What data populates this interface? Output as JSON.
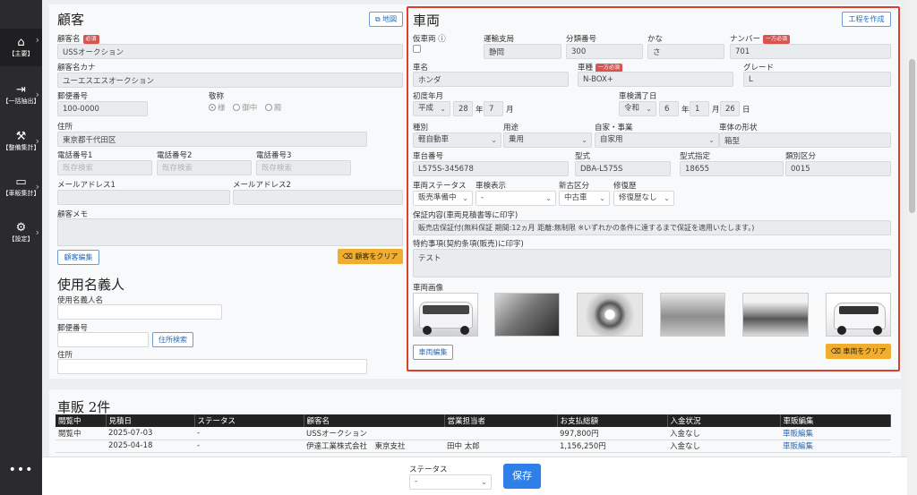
{
  "sidebar": {
    "items": [
      {
        "label": "【主要】",
        "icon": "home-icon",
        "glyph": "🏠"
      },
      {
        "label": "【一括抽出】",
        "icon": "export-icon",
        "glyph": "⮕"
      },
      {
        "label": "【整備集計】",
        "icon": "wrench-icon",
        "glyph": "🔧"
      },
      {
        "label": "【車販集計】",
        "icon": "car-icon",
        "glyph": "🚗"
      },
      {
        "label": "【設定】",
        "icon": "gear-icon",
        "glyph": "⚙"
      }
    ],
    "more": "•••"
  },
  "customer": {
    "title": "顧客",
    "map_button": "地図",
    "name_label": "顧客名",
    "required": "必須",
    "name": "USSオークション",
    "kana_label": "顧客名カナ",
    "kana": "ユーエスエスオークション",
    "postal_label": "郵便番号",
    "postal": "100-0000",
    "honorific_label": "敬称",
    "honorifics": [
      "様",
      "御中",
      "殿"
    ],
    "address_label": "住所",
    "address": "東京都千代田区",
    "phone1_label": "電話番号1",
    "phone2_label": "電話番号2",
    "phone3_label": "電話番号3",
    "phone_placeholder": "既存検索",
    "email1_label": "メールアドレス1",
    "email2_label": "メールアドレス2",
    "memo_label": "顧客メモ",
    "edit_button": "顧客編集",
    "clear_button": "顧客をクリア"
  },
  "nominee": {
    "title": "使用名義人",
    "name_label": "使用名義人名",
    "postal_label": "郵便番号",
    "search_button": "住所検索",
    "address_label": "住所"
  },
  "vehicle": {
    "title": "車両",
    "create_button": "工程を作成",
    "temp_label": "仮車両",
    "bureau_label": "運輸支局",
    "bureau": "静岡",
    "class_label": "分類番号",
    "class": "300",
    "kana_label": "かな",
    "kana": "さ",
    "number_label": "ナンバー",
    "number_req": "一方必須",
    "number": "701",
    "maker_label": "車名",
    "maker": "ホンダ",
    "model_label": "車種",
    "model_req": "一方必須",
    "model": "N-BOX+",
    "grade_label": "グレード",
    "grade": "L",
    "first_reg_label": "初度年月",
    "first_era": "平成",
    "first_year": "28",
    "first_month": "7",
    "year_unit": "年",
    "month_unit": "月",
    "day_unit": "日",
    "inspection_label": "車検満了日",
    "insp_era": "令和",
    "insp_year": "6",
    "insp_month": "1",
    "insp_day": "26",
    "type_label": "種別",
    "type": "軽自動車",
    "usage_label": "用途",
    "usage": "乗用",
    "biz_label": "自家・事業",
    "biz": "自家用",
    "body_label": "車体の形状",
    "body": "箱型",
    "chassis_label": "車台番号",
    "chassis": "L575S-345678",
    "katashiki_label": "型式",
    "katashiki": "DBA-L575S",
    "katashiki_spec_label": "型式指定",
    "katashiki_spec": "18655",
    "category_label": "類別区分",
    "category": "0015",
    "status_label": "車両ステータス",
    "status": "販売準備中",
    "insp_display_label": "車検表示",
    "insp_display": "-",
    "newused_label": "新古区分",
    "newused": "中古車",
    "repair_label": "修復歴",
    "repair": "修復歴なし",
    "warranty_label": "保証内容(車両見積書等に印字)",
    "warranty": "販売店保証付(無料保証 期間:12ヵ月 距離:無制限 ※いずれかの条件に達するまで保証を適用いたします。)",
    "special_label": "特約事項(契約条項(販売)に印字)",
    "special": "テスト",
    "images_label": "車両画像",
    "edit_button": "車両編集",
    "clear_button": "車両をクリア"
  },
  "sales": {
    "title": "車販 2件",
    "columns": [
      "閲覧中",
      "見積日",
      "ステータス",
      "顧客名",
      "営業担当者",
      "お支払総額",
      "入金状況",
      "車販編集"
    ],
    "rows": [
      [
        "閲覧中",
        "2025-07-03",
        "-",
        "USSオークション",
        "",
        "997,800円",
        "入金なし",
        "車販編集"
      ],
      [
        "",
        "2025-04-18",
        "-",
        "伊達工業株式会社　東京支社",
        "田中 太郎",
        "1,156,250円",
        "入金なし",
        "車販編集"
      ]
    ]
  },
  "footer": {
    "status_label": "ステータス",
    "status_value": "-",
    "save_button": "保存"
  }
}
